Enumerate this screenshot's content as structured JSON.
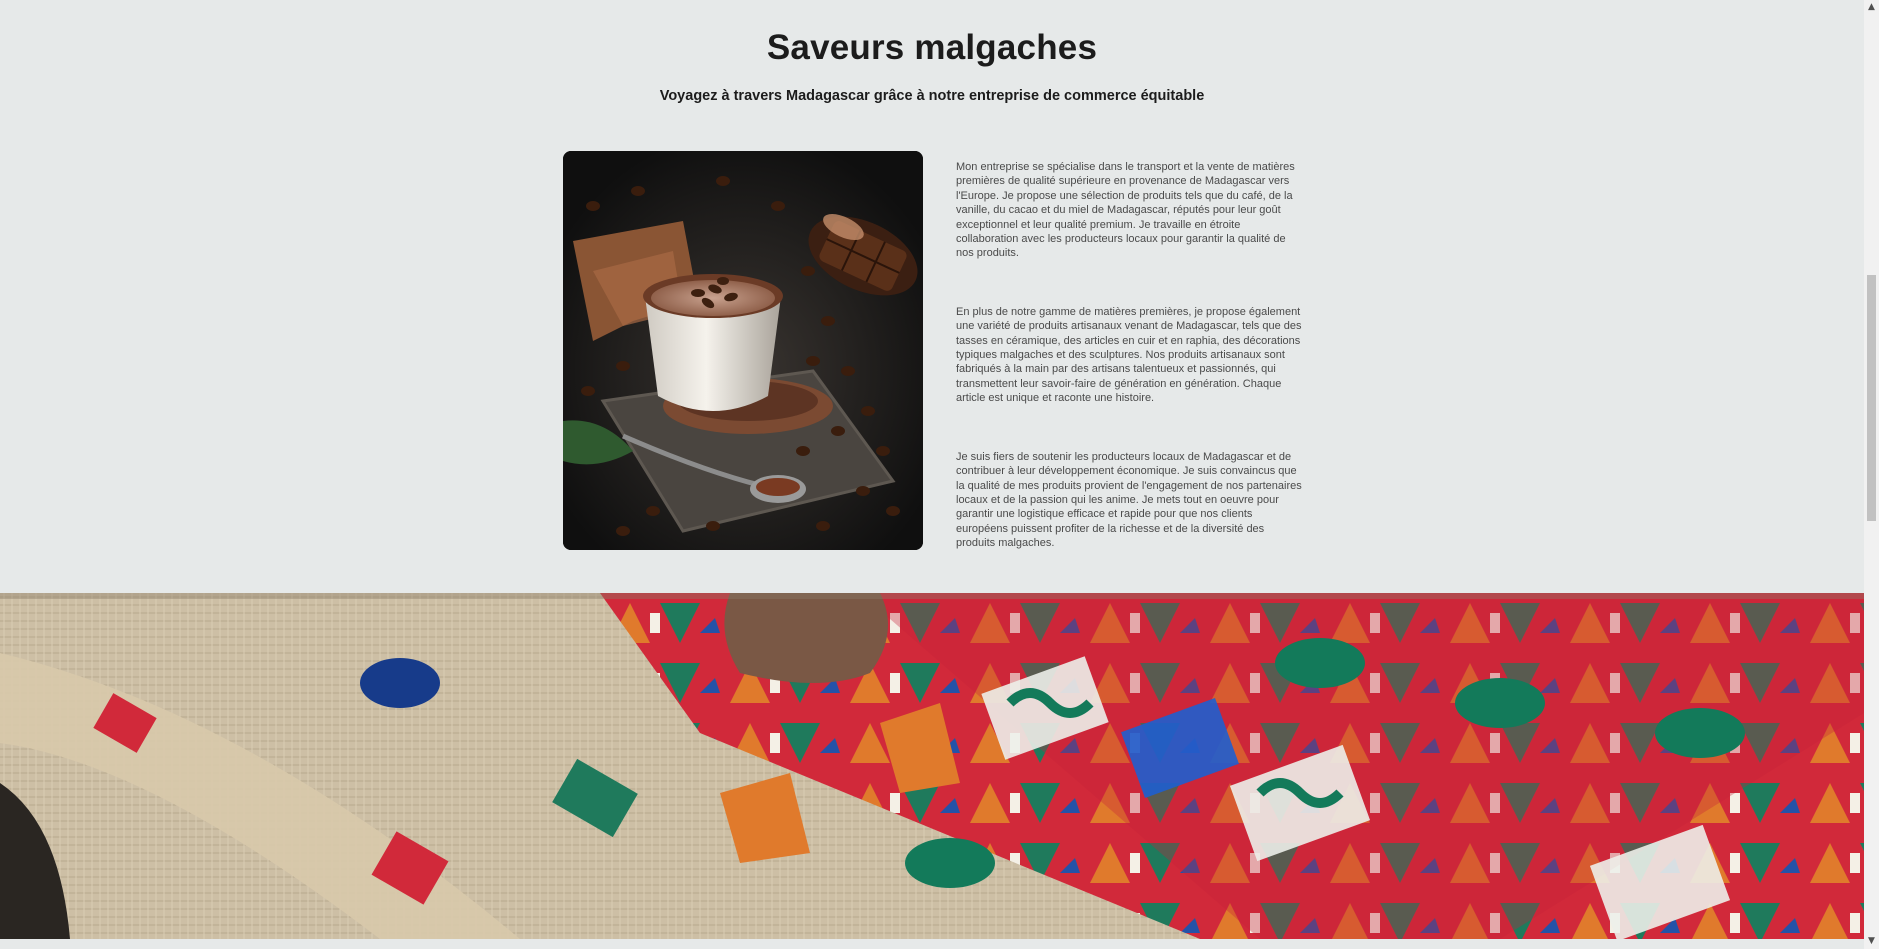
{
  "hero": {
    "title": "Saveurs malgaches",
    "subtitle": "Voyagez à travers Madagascar grâce à notre entreprise de commerce équitable"
  },
  "about": {
    "paragraphs": [
      "Mon entreprise se spécialise dans le transport et la vente de matières premières de qualité supérieure en provenance de Madagascar vers l'Europe. Je propose une sélection de produits tels que du café, de la vanille, du cacao et du miel de Madagascar, réputés pour leur goût exceptionnel et leur qualité premium. Je travaille en étroite collaboration avec les producteurs locaux pour garantir la qualité de nos produits.",
      "En plus de notre gamme de matières premières, je propose également une variété de produits artisanaux venant de Madagascar, tels que des tasses en céramique, des articles en cuir et en raphia, des décorations typiques malgaches et des sculptures. Nos produits artisanaux sont fabriqués à la main par des artisans talentueux et passionnés, qui transmettent leur savoir-faire de génération en génération. Chaque article est unique et raconte une histoire.",
      "Je suis fiers de soutenir les producteurs locaux de Madagascar et de contribuer à leur développement économique. Je suis convaincus que la qualité de mes produits provient de l'engagement de nos partenaires locaux et de la passion qui les anime. Je mets tout en oeuvre pour garantir une logistique efficace et rapide pour que nos clients européens puissent profiter de la richesse et de la diversité des produits malgaches."
    ]
  },
  "images": {
    "cocoa_photo": "hot chocolate cup with coffee beans and chocolate bar",
    "textile_banner": "colorful Malagasy embroidered textile with hand"
  },
  "scrollbar": {
    "up_icon": "▲",
    "down_icon": "▼"
  },
  "colors": {
    "background": "#e6e9e9",
    "heading": "#1c1c1c",
    "body_text": "#4a4a4a"
  }
}
